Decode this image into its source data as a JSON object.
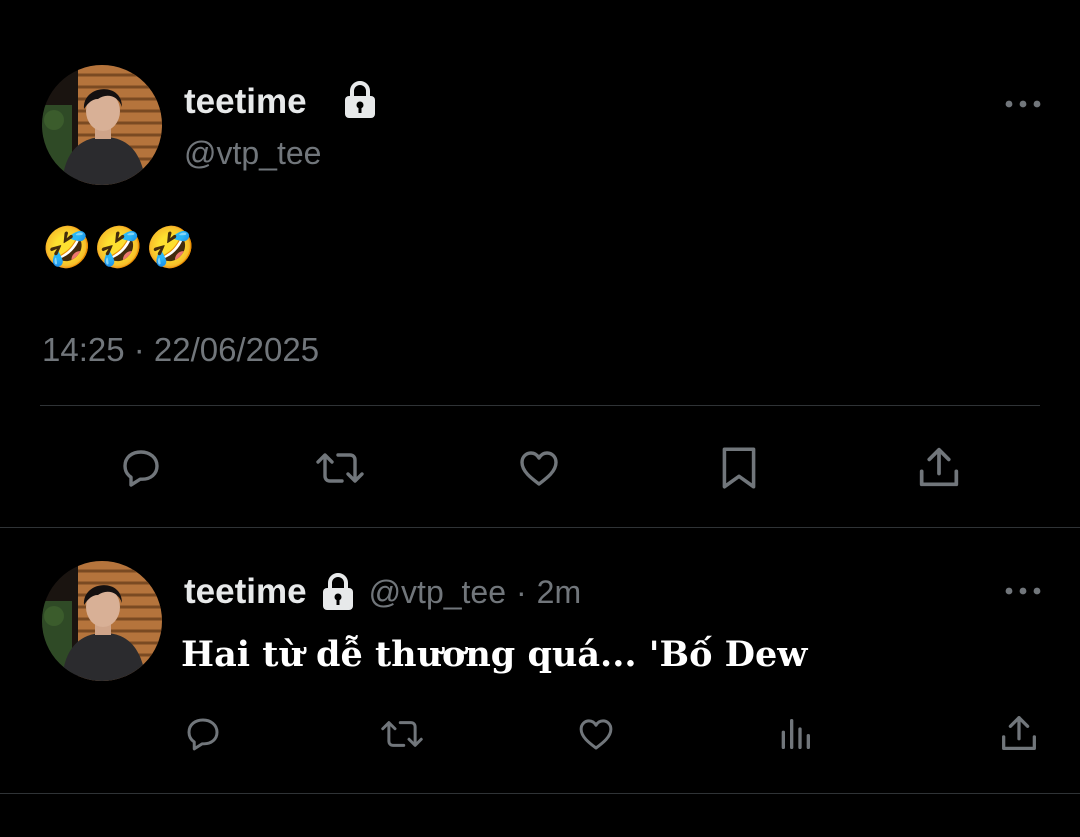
{
  "main_tweet": {
    "author": {
      "display_name": "teetime",
      "handle": "@vtp_tee",
      "protected_icon": "lock-icon",
      "avatar": "profile-photo"
    },
    "more_icon": "more-horizontal-icon",
    "text": "🤣🤣🤣",
    "timestamp": "14:25 · 22/06/2025",
    "actions": [
      {
        "name": "reply",
        "icon": "reply-icon"
      },
      {
        "name": "retweet",
        "icon": "retweet-icon"
      },
      {
        "name": "like",
        "icon": "heart-icon"
      },
      {
        "name": "bookmark",
        "icon": "bookmark-icon"
      },
      {
        "name": "share",
        "icon": "share-icon"
      }
    ]
  },
  "reply_tweet": {
    "author": {
      "display_name": "teetime",
      "handle": "@vtp_tee",
      "protected_icon": "lock-icon",
      "avatar": "profile-photo"
    },
    "separator": "·",
    "relative_time": "2m",
    "more_icon": "more-horizontal-icon",
    "text": "Hai từ dễ thương quá... 'Bố Dew",
    "actions": [
      {
        "name": "reply",
        "icon": "reply-icon"
      },
      {
        "name": "retweet",
        "icon": "retweet-icon"
      },
      {
        "name": "like",
        "icon": "heart-icon"
      },
      {
        "name": "views",
        "icon": "analytics-icon"
      },
      {
        "name": "share",
        "icon": "share-icon"
      }
    ]
  },
  "colors": {
    "background": "#000000",
    "primary_text": "#e7e9ea",
    "secondary_text": "#71767b",
    "divider": "#2f3336",
    "icon": "#71767b"
  }
}
